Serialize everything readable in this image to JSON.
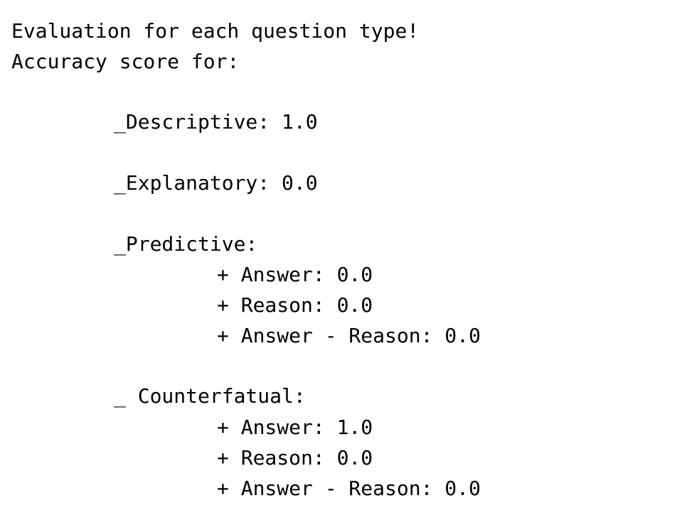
{
  "output": {
    "title": "Evaluation for each question type!",
    "subtitle": "Accuracy score for:",
    "descriptive": "_Descriptive: 1.0",
    "explanatory": "_Explanatory: 0.0",
    "predictive": {
      "heading": "_Predictive:",
      "answer": "+ Answer: 0.0",
      "reason": "+ Reason: 0.0",
      "answer_reason": "+ Answer - Reason: 0.0"
    },
    "counterfactual": {
      "heading": "_ Counterfatual:",
      "answer": "+ Answer: 1.0",
      "reason": "+ Reason: 0.0",
      "answer_reason": "+ Answer - Reason: 0.0"
    }
  },
  "colors": {
    "background": "#ffffff",
    "text": "#000000"
  }
}
